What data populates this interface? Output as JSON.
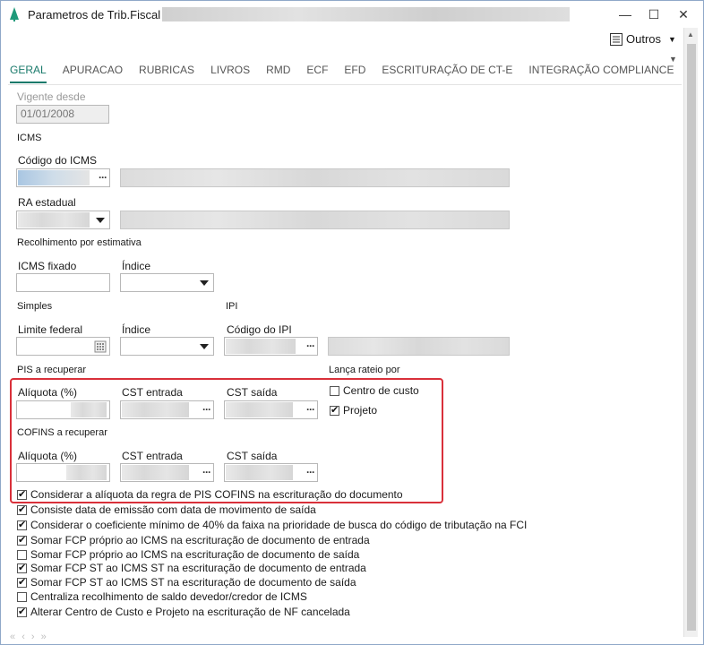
{
  "window": {
    "title": "Parametros de Trib.Fiscal",
    "controls": {
      "minimize": "—",
      "maximize": "☐",
      "close": "✕"
    }
  },
  "toolbar": {
    "outros_label": "Outros"
  },
  "tabs": [
    {
      "label": "GERAL",
      "active": true
    },
    {
      "label": "APURACAO"
    },
    {
      "label": "RUBRICAS"
    },
    {
      "label": "LIVROS"
    },
    {
      "label": "RMD"
    },
    {
      "label": "ECF"
    },
    {
      "label": "EFD"
    },
    {
      "label": "ESCRITURAÇÃO DE CT-E"
    },
    {
      "label": "INTEGRAÇÃO COMPLIANCE"
    }
  ],
  "form": {
    "vigente_label": "Vigente desde",
    "vigente_value": "01/01/2008",
    "icms_section": "ICMS",
    "codigo_icms_label": "Código do ICMS",
    "ra_estadual_label": "RA estadual",
    "recolhimento_section": "Recolhimento por estimativa",
    "icms_fixado_label": "ICMS fixado",
    "indice_label_1": "Índice",
    "simples_section": "Simples",
    "ipi_section": "IPI",
    "limite_federal_label": "Limite federal",
    "indice_label_2": "Índice",
    "codigo_ipi_label": "Código do IPI",
    "pis_section": "PIS a recuperar",
    "lanca_rateio_label": "Lança rateio por",
    "pis_aliquota_label": "Alíquota (%)",
    "pis_cst_entrada_label": "CST entrada",
    "pis_cst_saida_label": "CST saída",
    "centro_custo_label": "Centro de custo",
    "centro_custo_checked": false,
    "projeto_label": "Projeto",
    "projeto_checked": true,
    "cofins_section": "COFINS a recuperar",
    "cofins_aliquota_label": "Alíquota (%)",
    "cofins_cst_entrada_label": "CST entrada",
    "cofins_cst_saida_label": "CST saída"
  },
  "checkboxes": [
    {
      "label": "Considerar a alíquota da regra de PIS COFINS na escrituração do documento",
      "checked": true
    },
    {
      "label": "Consiste data de emissão com data de movimento de saída",
      "checked": true
    },
    {
      "label": "Considerar o coeficiente mínimo de 40% da faixa na prioridade de busca do código de tributação na FCI",
      "checked": true
    },
    {
      "label": "Somar FCP próprio ao ICMS na escrituração de documento de entrada",
      "checked": true
    },
    {
      "label": "Somar FCP próprio ao ICMS na escrituração de documento de saída",
      "checked": false
    },
    {
      "label": "Somar FCP ST ao ICMS ST na escrituração de documento de entrada",
      "checked": true
    },
    {
      "label": "Somar FCP ST ao ICMS ST na escrituração de documento de saída",
      "checked": true
    },
    {
      "label": "Centraliza recolhimento de saldo devedor/credor de ICMS",
      "checked": false
    },
    {
      "label": "Alterar Centro de Custo e Projeto na escrituração de NF cancelada",
      "checked": true
    }
  ]
}
